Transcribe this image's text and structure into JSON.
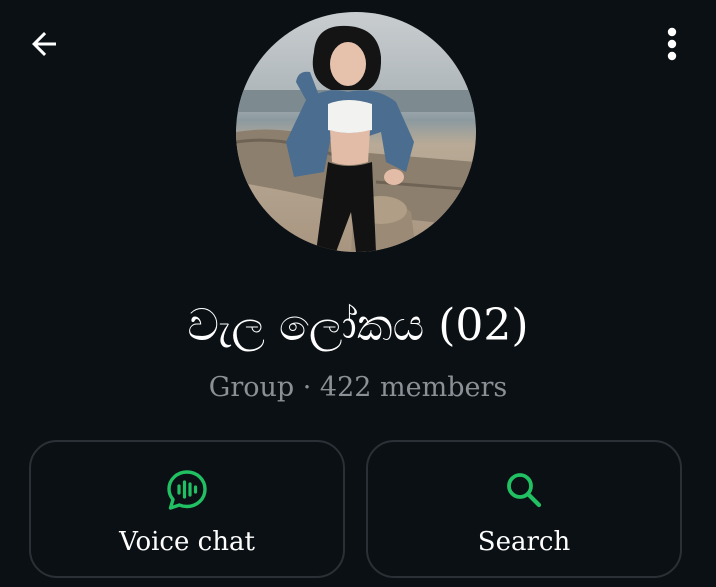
{
  "header": {
    "back_icon": "arrow-left-icon",
    "menu_icon": "more-vertical-icon"
  },
  "profile": {
    "avatar_description": "group-photo",
    "group_name": "වැල ලෝකය (02)",
    "subtitle": "Group · 422 members"
  },
  "actions": [
    {
      "label": "Voice chat",
      "icon": "voice-chat-icon"
    },
    {
      "label": "Search",
      "icon": "search-icon"
    }
  ],
  "colors": {
    "background": "#0b1014",
    "accent_green": "#21c063",
    "text_primary": "#ffffff",
    "text_secondary": "#8a9096",
    "button_border": "#2a3035"
  }
}
